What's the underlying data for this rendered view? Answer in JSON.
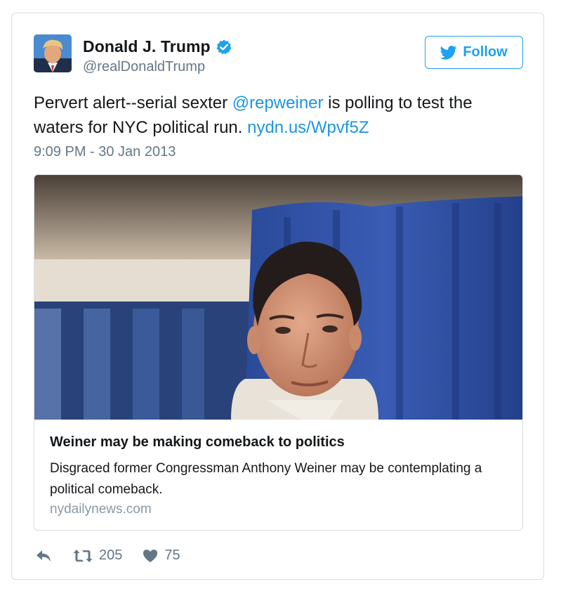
{
  "author": {
    "display_name": "Donald J. Trump",
    "handle": "@realDonaldTrump",
    "verified": true
  },
  "follow_button": {
    "label": "Follow"
  },
  "tweet": {
    "text_before": "Pervert alert--serial sexter ",
    "mention": "@repweiner",
    "text_middle": " is polling to test the waters for NYC political run. ",
    "url": "nydn.us/Wpvf5Z",
    "timestamp": "9:09 PM - 30 Jan 2013"
  },
  "card": {
    "title": "Weiner may be making comeback to politics",
    "description": "Disgraced former Congressman Anthony Weiner may be contemplating a political comeback.",
    "domain": "nydailynews.com"
  },
  "actions": {
    "reply_icon": "reply-icon",
    "retweet_icon": "retweet-icon",
    "retweet_count": "205",
    "like_icon": "heart-icon",
    "like_count": "75"
  },
  "colors": {
    "accent": "#1da1f2",
    "link": "#1b95e0",
    "secondary_text": "#657786",
    "border": "#d8dde2"
  }
}
